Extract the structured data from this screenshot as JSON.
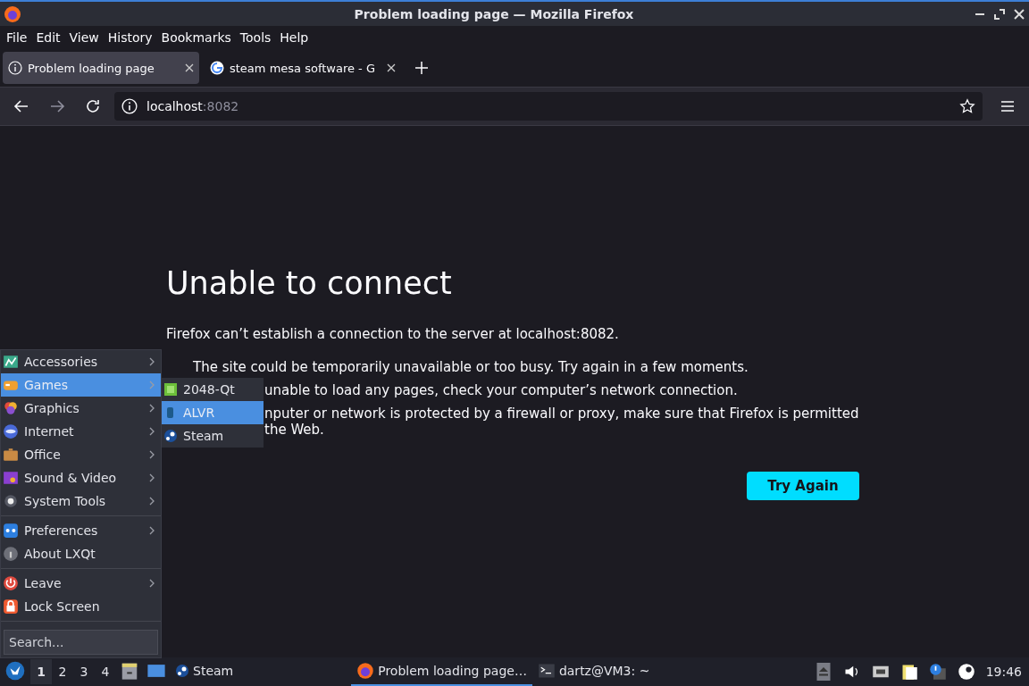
{
  "window": {
    "title": "Problem loading page — Mozilla Firefox"
  },
  "menu_bar": [
    {
      "label": "File"
    },
    {
      "label": "Edit"
    },
    {
      "label": "View"
    },
    {
      "label": "History"
    },
    {
      "label": "Bookmarks"
    },
    {
      "label": "Tools"
    },
    {
      "label": "Help"
    }
  ],
  "tabs": [
    {
      "label": "Problem loading page",
      "selected": true
    },
    {
      "label": "steam mesa software - G",
      "selected": false
    }
  ],
  "address_bar": {
    "host": "localhost",
    "port": ":8082"
  },
  "error_page": {
    "title": "Unable to connect",
    "message": "Firefox can’t establish a connection to the server at localhost:8082.",
    "bullets": [
      {
        "kind": "full",
        "lines": [
          "The site could be temporarily unavailable or too busy. Try again in a few moments."
        ]
      },
      {
        "kind": "covered",
        "lines": [
          "unable to load any pages, check your computer’s network connection."
        ]
      },
      {
        "kind": "covered",
        "lines": [
          "nputer or network is protected by a firewall or proxy, make sure that Firefox is permitted",
          "the Web."
        ]
      }
    ],
    "button": "Try Again"
  },
  "app_menu": {
    "groups": [
      [
        {
          "label": "Accessories",
          "has_submenu": true,
          "selected": false
        },
        {
          "label": "Games",
          "has_submenu": true,
          "selected": true
        },
        {
          "label": "Graphics",
          "has_submenu": true,
          "selected": false
        },
        {
          "label": "Internet",
          "has_submenu": true,
          "selected": false
        },
        {
          "label": "Office",
          "has_submenu": true,
          "selected": false
        },
        {
          "label": "Sound & Video",
          "has_submenu": true,
          "selected": false
        },
        {
          "label": "System Tools",
          "has_submenu": true,
          "selected": false
        }
      ],
      [
        {
          "label": "Preferences",
          "has_submenu": true,
          "selected": false
        },
        {
          "label": "About LXQt",
          "has_submenu": false,
          "selected": false
        }
      ],
      [
        {
          "label": "Leave",
          "has_submenu": true,
          "selected": false
        },
        {
          "label": "Lock Screen",
          "has_submenu": false,
          "selected": false
        }
      ]
    ],
    "search": {
      "placeholder": "Search..."
    }
  },
  "submenu": {
    "items": [
      {
        "label": "2048-Qt",
        "selected": false
      },
      {
        "label": "ALVR",
        "selected": true
      },
      {
        "label": "Steam",
        "selected": false
      }
    ]
  },
  "taskbar": {
    "desktops": [
      {
        "label": "1",
        "selected": true
      },
      {
        "label": "2",
        "selected": false
      },
      {
        "label": "3",
        "selected": false
      },
      {
        "label": "4",
        "selected": false
      }
    ],
    "quicklaunch_label": "Steam",
    "tasks": [
      {
        "label": "Problem loading page…",
        "selected": true
      },
      {
        "label": "dartz@VM3: ~",
        "selected": false
      }
    ],
    "clock": "19:46"
  }
}
